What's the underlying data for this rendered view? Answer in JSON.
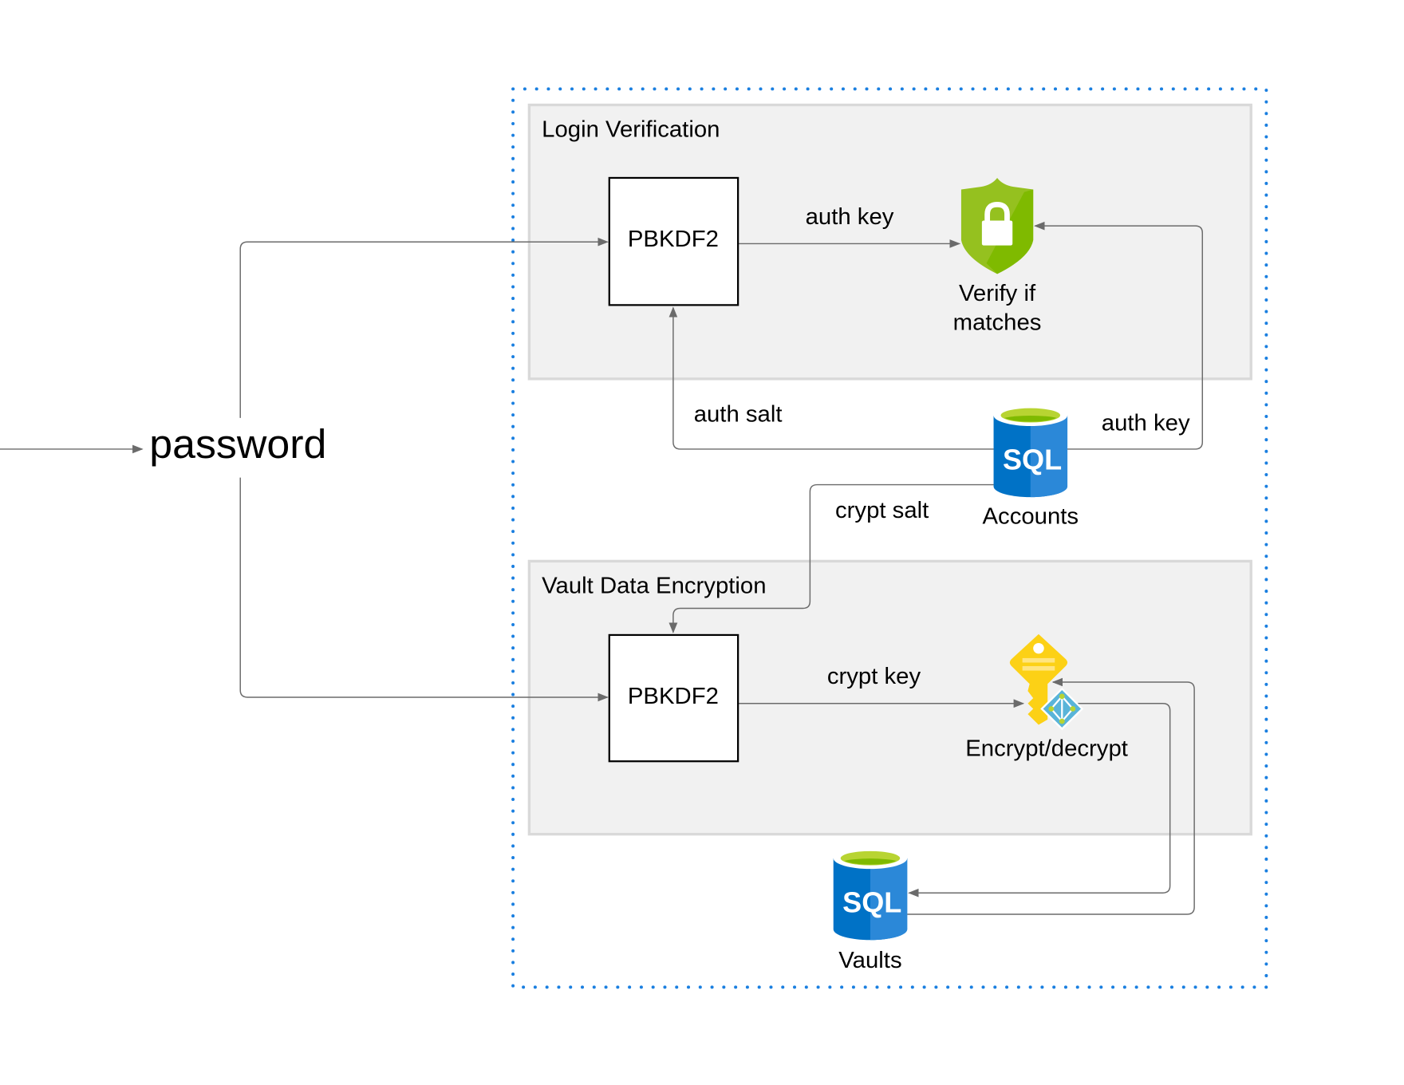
{
  "input": {
    "label": "password"
  },
  "groups": {
    "login": {
      "title": "Login Verification"
    },
    "vault": {
      "title": "Vault Data Encryption"
    }
  },
  "nodes": {
    "pbkdf2_login": "PBKDF2",
    "pbkdf2_vault": "PBKDF2",
    "verify": {
      "line1": "Verify if",
      "line2": "matches",
      "icon": "shield-lock-icon"
    },
    "accounts": {
      "label": "Accounts",
      "icon": "sql-database-icon"
    },
    "vaults": {
      "label": "Vaults",
      "icon": "sql-database-icon"
    },
    "encrypt": {
      "label": "Encrypt/decrypt",
      "icon": "key-vault-icon"
    }
  },
  "edges": {
    "auth_key_1": "auth key",
    "auth_key_2": "auth key",
    "auth_salt": "auth salt",
    "crypt_salt": "crypt salt",
    "crypt_key": "crypt key"
  },
  "icon_text": {
    "sql": "SQL"
  },
  "colors": {
    "boundary": "#1a7fe0",
    "group_fill": "#f1f1f1",
    "group_stroke": "#d9d9d9",
    "sql_blue": "#0072c6",
    "shield_green": "#7fba00",
    "key_yellow": "#fcd116"
  }
}
